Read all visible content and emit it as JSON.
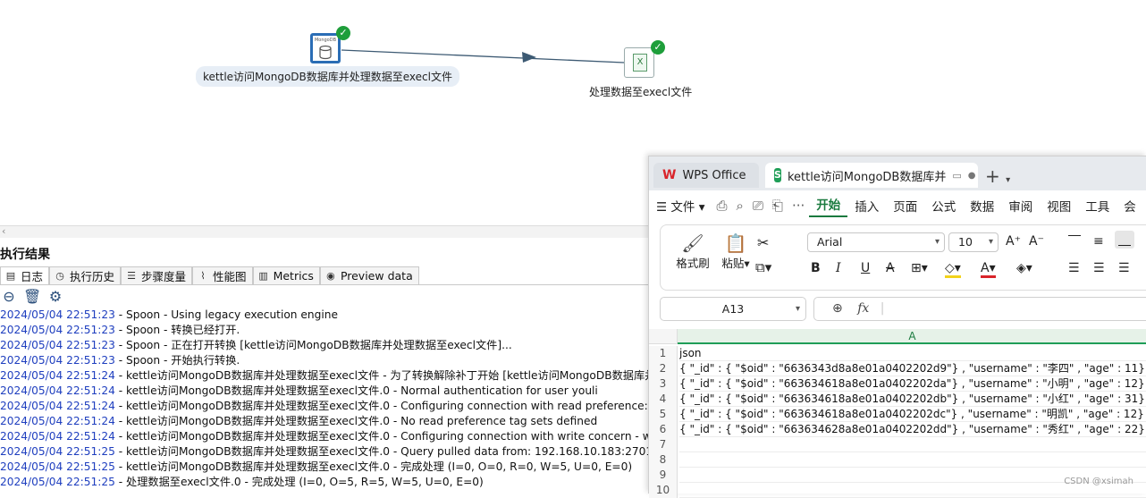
{
  "canvas": {
    "step_input_label": "kettle访问MongoDB数据库并处理数据至execl文件",
    "step_input_icon_text": "MongoDB",
    "step_output_label": "处理数据至execl文件",
    "step_output_icon_text": "X"
  },
  "results": {
    "title": "执行结果",
    "tabs": [
      {
        "label": "日志",
        "icon": "log-icon"
      },
      {
        "label": "执行历史",
        "icon": "history-icon"
      },
      {
        "label": "步骤度量",
        "icon": "step-metrics-icon"
      },
      {
        "label": "性能图",
        "icon": "performance-chart-icon"
      },
      {
        "label": "Metrics",
        "icon": "metrics-icon"
      },
      {
        "label": "Preview data",
        "icon": "preview-eye-icon"
      }
    ],
    "log": [
      {
        "ts": "2024/05/04 22:51:23",
        "msg": " - Spoon - Using legacy execution engine"
      },
      {
        "ts": "2024/05/04 22:51:23",
        "msg": " - Spoon - 转换已经打开."
      },
      {
        "ts": "2024/05/04 22:51:23",
        "msg": " - Spoon - 正在打开转换 [kettle访问MongoDB数据库并处理数据至execl文件]..."
      },
      {
        "ts": "2024/05/04 22:51:23",
        "msg": " - Spoon - 开始执行转换."
      },
      {
        "ts": "2024/05/04 22:51:24",
        "msg": " - kettle访问MongoDB数据库并处理数据至execl文件 - 为了转换解除补丁开始  [kettle访问MongoDB数据库并处"
      },
      {
        "ts": "2024/05/04 22:51:24",
        "msg": " - kettle访问MongoDB数据库并处理数据至execl文件.0 - Normal authentication for user youli"
      },
      {
        "ts": "2024/05/04 22:51:24",
        "msg": " - kettle访问MongoDB数据库并处理数据至execl文件.0 - Configuring connection with read preference: prima"
      },
      {
        "ts": "2024/05/04 22:51:24",
        "msg": " - kettle访问MongoDB数据库并处理数据至execl文件.0 - No read preference tag sets defined"
      },
      {
        "ts": "2024/05/04 22:51:24",
        "msg": " - kettle访问MongoDB数据库并处理数据至execl文件.0 - Configuring connection with write concern - w = 1,"
      },
      {
        "ts": "2024/05/04 22:51:25",
        "msg": " - kettle访问MongoDB数据库并处理数据至execl文件.0 - Query pulled data from: 192.168.10.183:27017"
      },
      {
        "ts": "2024/05/04 22:51:25",
        "msg": " - kettle访问MongoDB数据库并处理数据至execl文件.0 - 完成处理 (I=0, O=0, R=0, W=5, U=0, E=0)"
      },
      {
        "ts": "2024/05/04 22:51:25",
        "msg": " - 处理数据至execl文件.0 - 完成处理 (I=0, O=5, R=5, W=5, U=0, E=0)"
      }
    ]
  },
  "wps": {
    "tab_office": "WPS Office",
    "tab_doc": "kettle访问MongoDB数据库并",
    "menu": [
      "开始",
      "插入",
      "页面",
      "公式",
      "数据",
      "审阅",
      "视图",
      "工具",
      "会"
    ],
    "file_menu": "文件",
    "ribbon": {
      "format_painter": "格式刷",
      "paste": "粘贴",
      "font_name": "Arial",
      "font_size": "10"
    },
    "name_box": "A13",
    "fx": "fx",
    "column": "A",
    "rows": [
      {
        "n": "1",
        "v": "json"
      },
      {
        "n": "2",
        "v": "{ \"_id\" : { \"$oid\" : \"6636343d8a8e01a0402202d9\"} , \"username\" : \"李四\" , \"age\" : 11}"
      },
      {
        "n": "3",
        "v": "{ \"_id\" : { \"$oid\" : \"663634618a8e01a0402202da\"} , \"username\" : \"小明\" , \"age\" : 12}"
      },
      {
        "n": "4",
        "v": "{ \"_id\" : { \"$oid\" : \"663634618a8e01a0402202db\"} , \"username\" : \"小红\" , \"age\" : 31}"
      },
      {
        "n": "5",
        "v": "{ \"_id\" : { \"$oid\" : \"663634618a8e01a0402202dc\"} , \"username\" : \"明凯\" , \"age\" : 12}"
      },
      {
        "n": "6",
        "v": "{ \"_id\" : { \"$oid\" : \"663634628a8e01a0402202dd\"} , \"username\" : \"秀红\" , \"age\" : 22}"
      },
      {
        "n": "7",
        "v": ""
      },
      {
        "n": "8",
        "v": ""
      },
      {
        "n": "9",
        "v": ""
      },
      {
        "n": "10",
        "v": ""
      }
    ]
  },
  "watermark": "CSDN @xsimah"
}
